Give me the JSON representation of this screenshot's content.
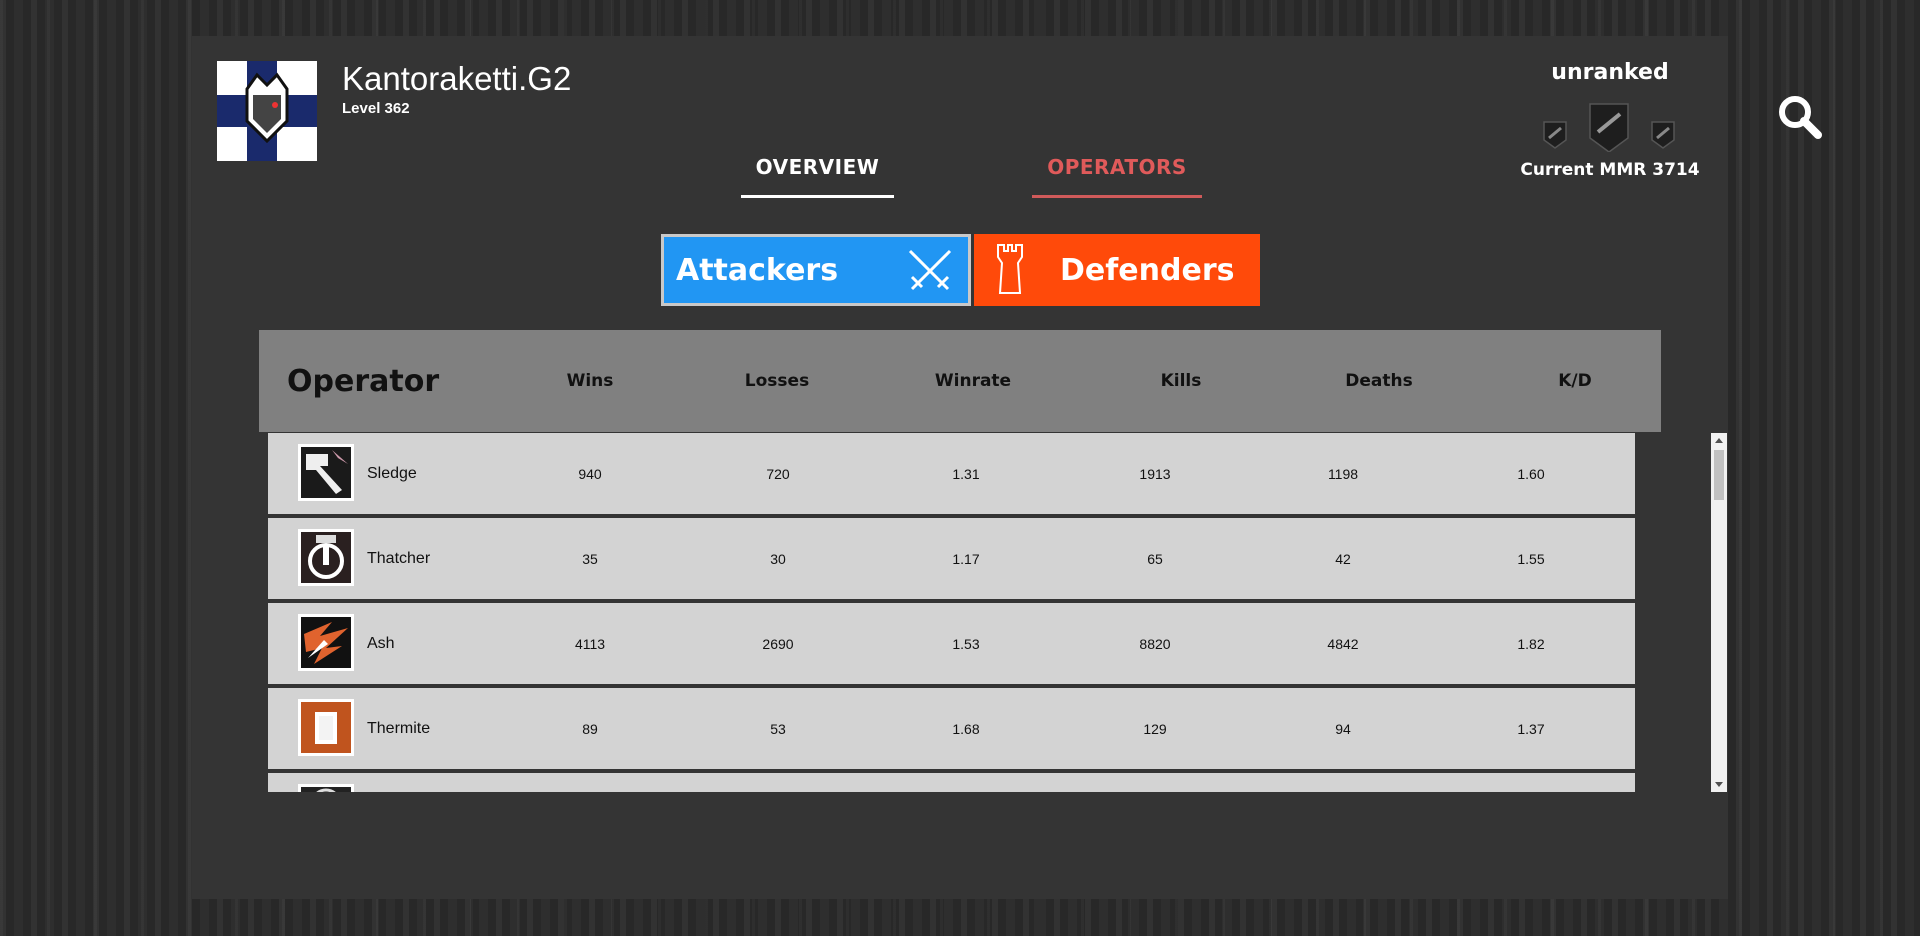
{
  "profile": {
    "username": "Kantoraketti.G2",
    "level": "Level 362"
  },
  "rank": {
    "title": "unranked",
    "mmr": "Current MMR 3714"
  },
  "tabs": [
    {
      "label": "OVERVIEW",
      "active": true
    },
    {
      "label": "OPERATORS",
      "active": false
    }
  ],
  "sides": {
    "attackers_label": "Attackers",
    "defenders_label": "Defenders"
  },
  "table": {
    "headers": [
      "Operator",
      "Wins",
      "Losses",
      "Winrate",
      "Kills",
      "Deaths",
      "K/D"
    ],
    "rows": [
      {
        "operator": "Sledge",
        "wins": "940",
        "losses": "720",
        "winrate": "1.31",
        "kills": "1913",
        "deaths": "1198",
        "kd": "1.60"
      },
      {
        "operator": "Thatcher",
        "wins": "35",
        "losses": "30",
        "winrate": "1.17",
        "kills": "65",
        "deaths": "42",
        "kd": "1.55"
      },
      {
        "operator": "Ash",
        "wins": "4113",
        "losses": "2690",
        "winrate": "1.53",
        "kills": "8820",
        "deaths": "4842",
        "kd": "1.82"
      },
      {
        "operator": "Thermite",
        "wins": "89",
        "losses": "53",
        "winrate": "1.68",
        "kills": "129",
        "deaths": "94",
        "kd": "1.37"
      }
    ]
  },
  "colors": {
    "attackers": "#2196f3",
    "defenders": "#ff4a0a",
    "operators_tab": "#e05a5a"
  },
  "icons": {
    "search": "search-icon",
    "attackers": "crossed-swords-icon",
    "defenders": "tower-icon"
  }
}
